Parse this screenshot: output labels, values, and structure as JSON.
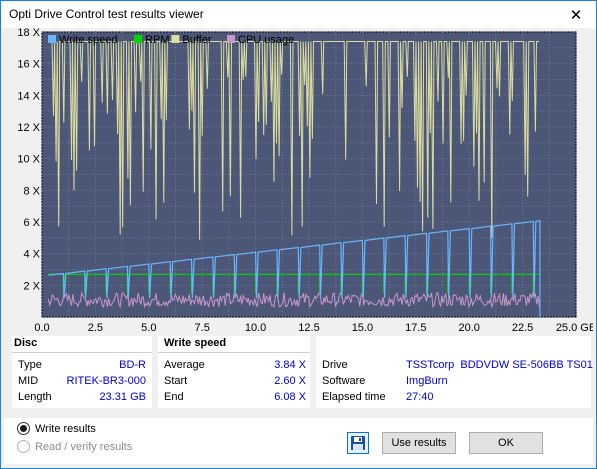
{
  "window": {
    "title": "Opti Drive Control test results viewer",
    "close_glyph": "✕"
  },
  "chart_data": {
    "type": "line",
    "legend": [
      "Write speed",
      "RPM",
      "Buffer",
      "CPU usage"
    ],
    "legend_colors": [
      "#69b6ff",
      "#00d800",
      "#dcdca0",
      "#c896c8"
    ],
    "colors": {
      "plot_bg": "#4c5778",
      "grid": "#6c7898"
    },
    "y_ticks": [
      "18 X",
      "16 X",
      "14 X",
      "12 X",
      "10 X",
      "8 X",
      "6 X",
      "4 X",
      "2 X"
    ],
    "x_ticks": [
      "0.0",
      "2.5",
      "5.0",
      "7.5",
      "10.0",
      "12.5",
      "15.0",
      "17.5",
      "20.0",
      "22.5",
      "25.0 GB"
    ],
    "xlim": [
      0,
      25
    ],
    "ylim": [
      0,
      18
    ],
    "series": [
      {
        "name": "Write speed",
        "x": [
          0,
          23.31
        ],
        "values": [
          2.6,
          6.08
        ]
      },
      {
        "name": "RPM",
        "x": [
          0,
          23.31
        ],
        "values": [
          2.7,
          2.7
        ]
      },
      {
        "name": "Buffer",
        "x": [
          0,
          23.31
        ],
        "values": [
          17.4,
          17.4
        ]
      },
      {
        "name": "CPU usage",
        "x": [
          0,
          23.31
        ],
        "values": [
          1.0,
          1.0
        ]
      }
    ]
  },
  "disc": {
    "header": "Disc",
    "rows": [
      {
        "label": "Type",
        "value": "BD-R"
      },
      {
        "label": "MID",
        "value": "RITEK-BR3-000"
      },
      {
        "label": "Length",
        "value": "23.31 GB"
      }
    ]
  },
  "write_speed": {
    "header": "Write speed",
    "rows": [
      {
        "label": "Average",
        "value": "3.84 X"
      },
      {
        "label": "Start",
        "value": "2.60 X"
      },
      {
        "label": "End",
        "value": "6.08 X"
      }
    ]
  },
  "drive_info": {
    "rows": [
      {
        "label": "Drive",
        "value": "TSSTcorp  BDDVDW SE-506BB TS01"
      },
      {
        "label": "Software",
        "value": "ImgBurn"
      },
      {
        "label": "Elapsed time",
        "value": "27:40"
      }
    ]
  },
  "options": {
    "write_results": "Write results",
    "read_verify": "Read / verify results"
  },
  "buttons": {
    "use_results": "Use results",
    "ok": "OK"
  }
}
